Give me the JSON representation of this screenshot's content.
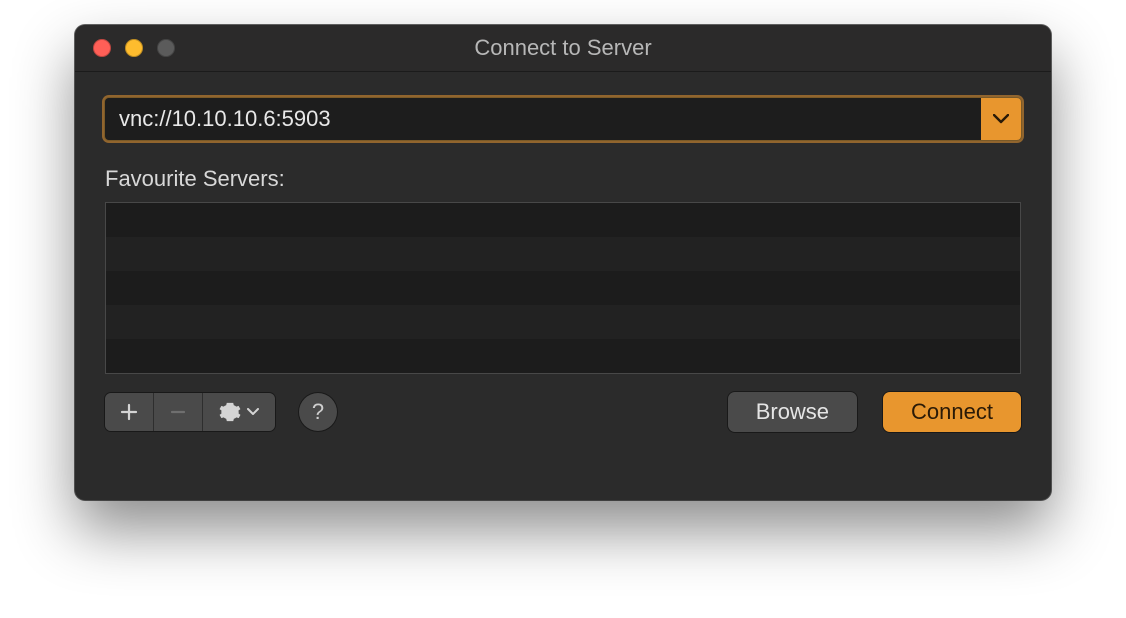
{
  "window": {
    "title": "Connect to Server"
  },
  "address": {
    "value": "vnc://10.10.10.6:5903"
  },
  "favourites": {
    "label": "Favourite Servers:",
    "items": []
  },
  "buttons": {
    "browse": "Browse",
    "connect": "Connect"
  },
  "icons": {
    "help": "?"
  }
}
